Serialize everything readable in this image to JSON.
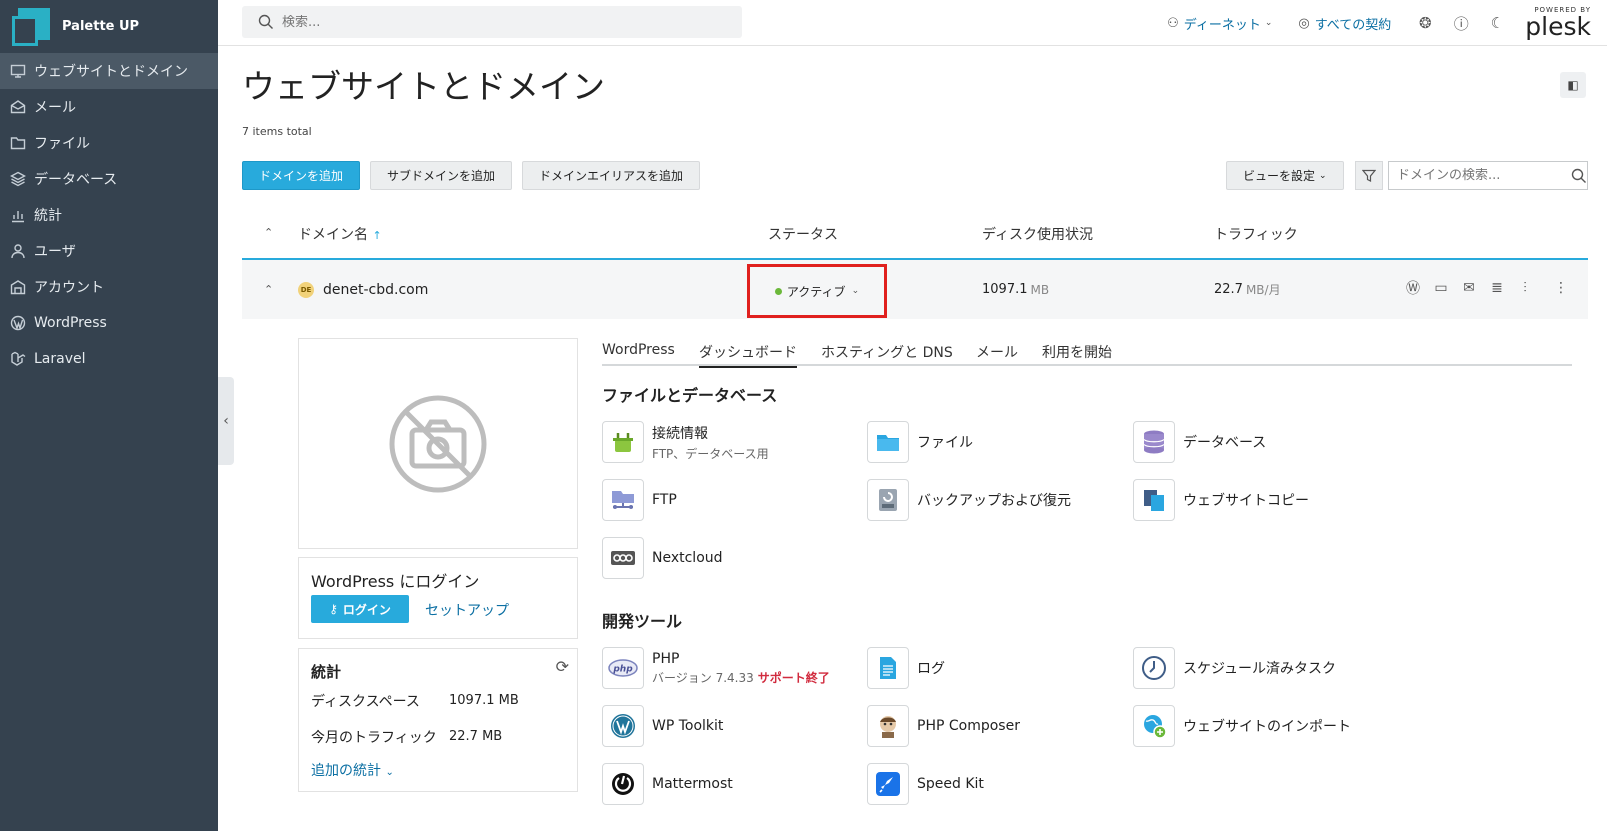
{
  "brand": {
    "name": "Palette UP",
    "accent": "#2ab0c5"
  },
  "sidebar": {
    "items": [
      {
        "label": "ウェブサイトとドメイン",
        "icon": "monitor-icon",
        "active": true
      },
      {
        "label": "メール",
        "icon": "mail-icon"
      },
      {
        "label": "ファイル",
        "icon": "folder-icon"
      },
      {
        "label": "データベース",
        "icon": "layers-icon"
      },
      {
        "label": "統計",
        "icon": "bar-chart-icon"
      },
      {
        "label": "ユーザ",
        "icon": "user-icon"
      },
      {
        "label": "アカウント",
        "icon": "account-icon"
      },
      {
        "label": "WordPress",
        "icon": "wordpress-icon"
      },
      {
        "label": "Laravel",
        "icon": "laravel-icon"
      }
    ]
  },
  "topbar": {
    "search_placeholder": "検索...",
    "user_label": "ディーネット",
    "subscriptions_label": "すべての契約",
    "powered_by": "POWERED BY",
    "plesk": "plesk"
  },
  "page": {
    "title": "ウェブサイトとドメイン",
    "items_total": "7 items total",
    "add_domain": "ドメインを追加",
    "add_subdomain": "サブドメインを追加",
    "add_alias": "ドメインエイリアスを追加",
    "view_settings": "ビューを設定",
    "domain_search_placeholder": "ドメインの検索..."
  },
  "table": {
    "col_domain": "ドメイン名",
    "col_status": "ステータス",
    "col_disk": "ディスク使用状況",
    "col_traffic": "トラフィック",
    "row": {
      "badge": "DE",
      "domain": "denet-cbd.com",
      "status": "アクティブ",
      "disk_value": "1097.1",
      "disk_unit": "MB",
      "traffic_value": "22.7",
      "traffic_unit": "MB/月"
    }
  },
  "wordpress_card": {
    "title": "WordPress にログイン",
    "login": "ログイン",
    "setup": "セットアップ"
  },
  "stats_card": {
    "title": "統計",
    "disk_label": "ディスクスペース",
    "disk_value": "1097.1 MB",
    "traffic_label": "今月のトラフィック",
    "traffic_value": "22.7 MB",
    "more": "追加の統計"
  },
  "tabs": [
    "WordPress",
    "ダッシュボード",
    "ホスティングと DNS",
    "メール",
    "利用を開始"
  ],
  "sections": {
    "files_db": "ファイルとデータベース",
    "dev_tools": "開発ツール"
  },
  "tools": {
    "connection": {
      "name": "接続情報",
      "sub": "FTP、データベース用"
    },
    "files": {
      "name": "ファイル"
    },
    "databases": {
      "name": "データベース"
    },
    "ftp": {
      "name": "FTP"
    },
    "backup": {
      "name": "バックアップおよび復元"
    },
    "site_copy": {
      "name": "ウェブサイトコピー"
    },
    "nextcloud": {
      "name": "Nextcloud"
    },
    "php": {
      "name": "PHP",
      "sub": "バージョン 7.4.33",
      "eol": "サポート終了"
    },
    "logs": {
      "name": "ログ"
    },
    "scheduled": {
      "name": "スケジュール済みタスク"
    },
    "wp_toolkit": {
      "name": "WP Toolkit"
    },
    "composer": {
      "name": "PHP Composer"
    },
    "import": {
      "name": "ウェブサイトのインポート"
    },
    "mattermost": {
      "name": "Mattermost"
    },
    "speedkit": {
      "name": "Speed Kit"
    }
  },
  "colors": {
    "primary": "#28aadc",
    "highlight": "#e0201e",
    "active_status": "#6bb83a",
    "sidebar_bg": "#35424f"
  }
}
